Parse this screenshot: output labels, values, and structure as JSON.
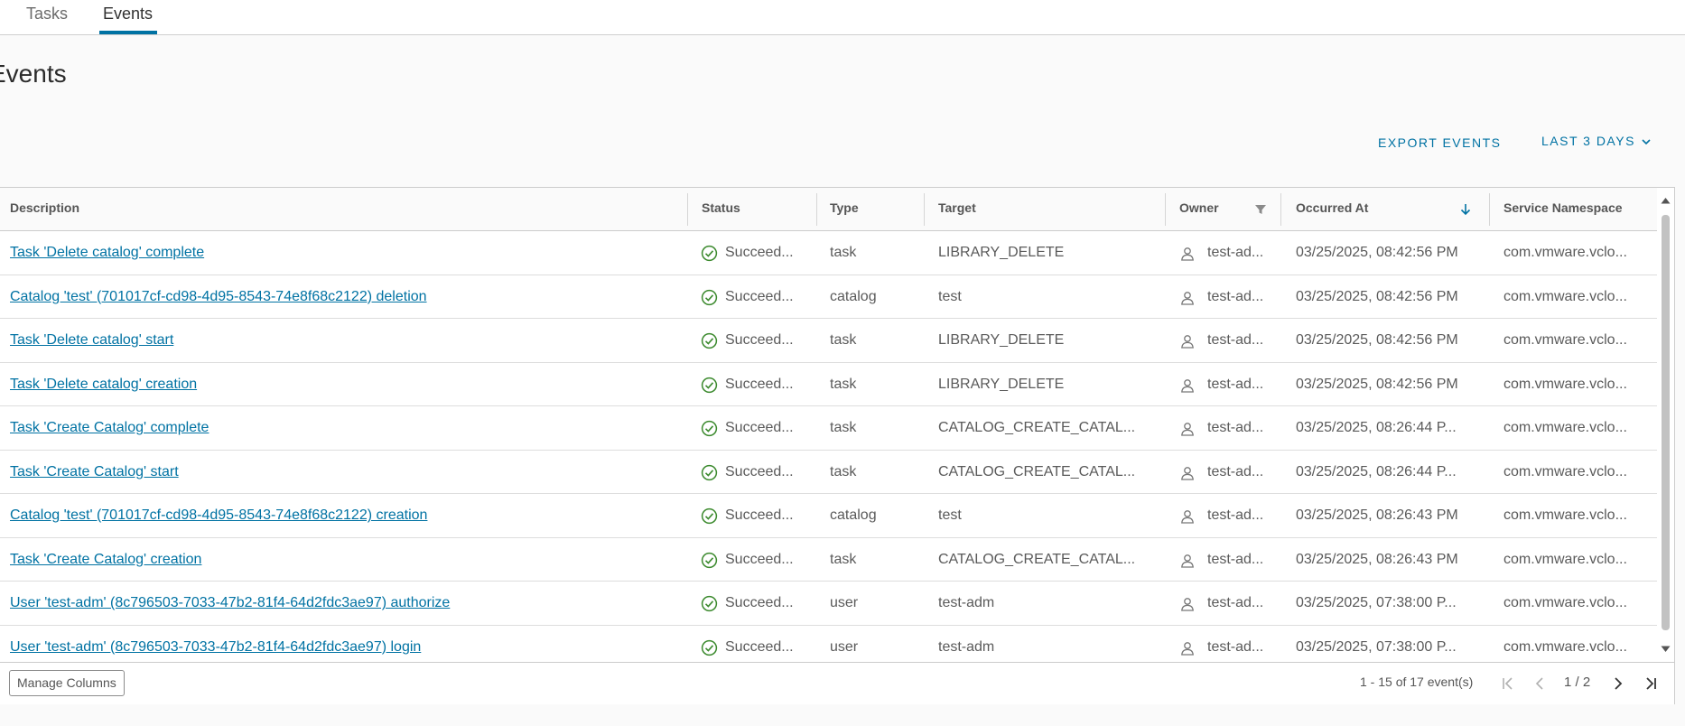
{
  "tabs": [
    {
      "label": "Tasks",
      "active": false
    },
    {
      "label": "Events",
      "active": true
    }
  ],
  "page_title": "Events",
  "actions": {
    "export_label": "EXPORT EVENTS",
    "range_label": "LAST 3 DAYS"
  },
  "columns": {
    "description": "Description",
    "status": "Status",
    "type": "Type",
    "target": "Target",
    "owner": "Owner",
    "occurred_at": "Occurred At",
    "service_namespace": "Service Namespace"
  },
  "rows": [
    {
      "description": "Task 'Delete catalog' complete",
      "status": "Succeed...",
      "type": "task",
      "target": "LIBRARY_DELETE",
      "owner": "test-ad...",
      "occurred_at": "03/25/2025, 08:42:56 PM",
      "namespace": "com.vmware.vclo..."
    },
    {
      "description": "Catalog 'test' (701017cf-cd98-4d95-8543-74e8f68c2122) deletion",
      "status": "Succeed...",
      "type": "catalog",
      "target": "test",
      "owner": "test-ad...",
      "occurred_at": "03/25/2025, 08:42:56 PM",
      "namespace": "com.vmware.vclo..."
    },
    {
      "description": "Task 'Delete catalog' start",
      "status": "Succeed...",
      "type": "task",
      "target": "LIBRARY_DELETE",
      "owner": "test-ad...",
      "occurred_at": "03/25/2025, 08:42:56 PM",
      "namespace": "com.vmware.vclo..."
    },
    {
      "description": "Task 'Delete catalog' creation",
      "status": "Succeed...",
      "type": "task",
      "target": "LIBRARY_DELETE",
      "owner": "test-ad...",
      "occurred_at": "03/25/2025, 08:42:56 PM",
      "namespace": "com.vmware.vclo..."
    },
    {
      "description": "Task 'Create Catalog' complete",
      "status": "Succeed...",
      "type": "task",
      "target": "CATALOG_CREATE_CATAL...",
      "owner": "test-ad...",
      "occurred_at": "03/25/2025, 08:26:44 P...",
      "namespace": "com.vmware.vclo..."
    },
    {
      "description": "Task 'Create Catalog' start",
      "status": "Succeed...",
      "type": "task",
      "target": "CATALOG_CREATE_CATAL...",
      "owner": "test-ad...",
      "occurred_at": "03/25/2025, 08:26:44 P...",
      "namespace": "com.vmware.vclo..."
    },
    {
      "description": "Catalog 'test' (701017cf-cd98-4d95-8543-74e8f68c2122) creation",
      "status": "Succeed...",
      "type": "catalog",
      "target": "test",
      "owner": "test-ad...",
      "occurred_at": "03/25/2025, 08:26:43 PM",
      "namespace": "com.vmware.vclo..."
    },
    {
      "description": "Task 'Create Catalog' creation",
      "status": "Succeed...",
      "type": "task",
      "target": "CATALOG_CREATE_CATAL...",
      "owner": "test-ad...",
      "occurred_at": "03/25/2025, 08:26:43 PM",
      "namespace": "com.vmware.vclo..."
    },
    {
      "description": "User 'test-adm' (8c796503-7033-47b2-81f4-64d2fdc3ae97) authorize",
      "status": "Succeed...",
      "type": "user",
      "target": "test-adm",
      "owner": "test-ad...",
      "occurred_at": "03/25/2025, 07:38:00 P...",
      "namespace": "com.vmware.vclo..."
    },
    {
      "description": "User 'test-adm' (8c796503-7033-47b2-81f4-64d2fdc3ae97) login",
      "status": "Succeed...",
      "type": "user",
      "target": "test-adm",
      "owner": "test-ad...",
      "occurred_at": "03/25/2025, 07:38:00 P...",
      "namespace": "com.vmware.vclo..."
    }
  ],
  "footer": {
    "manage_columns_label": "Manage Columns",
    "range_text": "1 - 15 of 17 event(s)",
    "page_text": "1 / 2"
  },
  "colors": {
    "accent": "#0072a3",
    "success": "#3c8a2e",
    "border": "#cccccc"
  },
  "icons": {
    "status": "check-circle-icon",
    "owner": "user-icon",
    "filter": "filter-icon",
    "sort": "sort-descending-icon"
  }
}
